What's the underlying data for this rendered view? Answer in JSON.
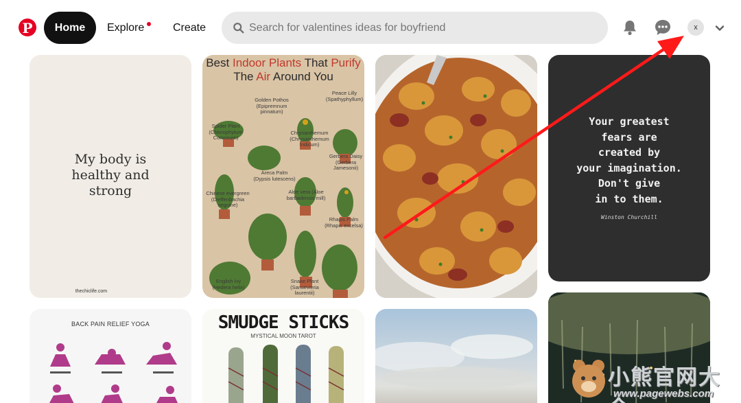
{
  "header": {
    "home_label": "Home",
    "explore_label": "Explore",
    "create_label": "Create",
    "search_placeholder": "Search for valentines ideas for boyfriend",
    "avatar_initial": "x",
    "brand_color": "#e60023"
  },
  "pins": {
    "p1": {
      "quote": "My body is healthy and strong",
      "site": "thechiclife.com"
    },
    "p2": {
      "title_part1": "Best ",
      "title_part2": "Indoor Plants",
      "title_part3": " That ",
      "title_part4": "Purify",
      "title_line2a": "The ",
      "title_line2b": "Air",
      "title_line2c": " Around You",
      "labels": [
        "Golden Pothos (Epipremnum pinnatum)",
        "Peace Lilly (Spathyphyllum)",
        "Spider Plant (Chlorophytum Comosum)",
        "Chrysanthemum (Chrysanthemum Indicum)",
        "Gerbera Daisy (Gerbera Jamesonii)",
        "Areca Palm (Dypsis lutescens)",
        "Chinese evergreen (Dieffenbachia seguine)",
        "Aloe vera (Aloe barbadensis mill)",
        "Rhapis Palm (Rhapis excelsa)",
        "English Ivy (Hedera helix)",
        "Snake Plant (Sansevieria laurentii)"
      ]
    },
    "p4": {
      "quote_lines": [
        "Your greatest",
        "fears are",
        "created by",
        "your imagination.",
        "Don't give",
        "in to them."
      ],
      "author": "Winston Churchill"
    },
    "p5": {
      "title": "BACK PAIN RELIEF YOGA"
    },
    "p6": {
      "title": "SMUDGE STICKS",
      "subtitle": "MYSTICAL MOON TAROT"
    }
  },
  "watermark": {
    "text_cn": "小熊官网大全",
    "url": "www.pagewebs.com"
  },
  "annotation": {
    "arrow_color": "#ff1a1a"
  }
}
